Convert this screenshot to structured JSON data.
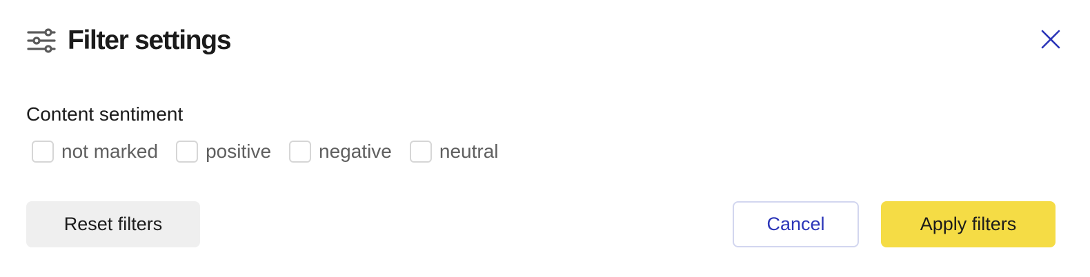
{
  "dialog": {
    "title": "Filter settings",
    "title_icon": "sliders-icon",
    "close_icon": "close-icon",
    "close_color": "#2b35b8"
  },
  "sentiment": {
    "label": "Content sentiment",
    "options": [
      {
        "label": "not marked",
        "checked": false
      },
      {
        "label": "positive",
        "checked": false
      },
      {
        "label": "negative",
        "checked": false
      },
      {
        "label": "neutral",
        "checked": false
      }
    ]
  },
  "actions": {
    "reset_label": "Reset filters",
    "cancel_label": "Cancel",
    "apply_label": "Apply filters",
    "apply_color": "#f5dc45",
    "cancel_color": "#2b35b8"
  }
}
